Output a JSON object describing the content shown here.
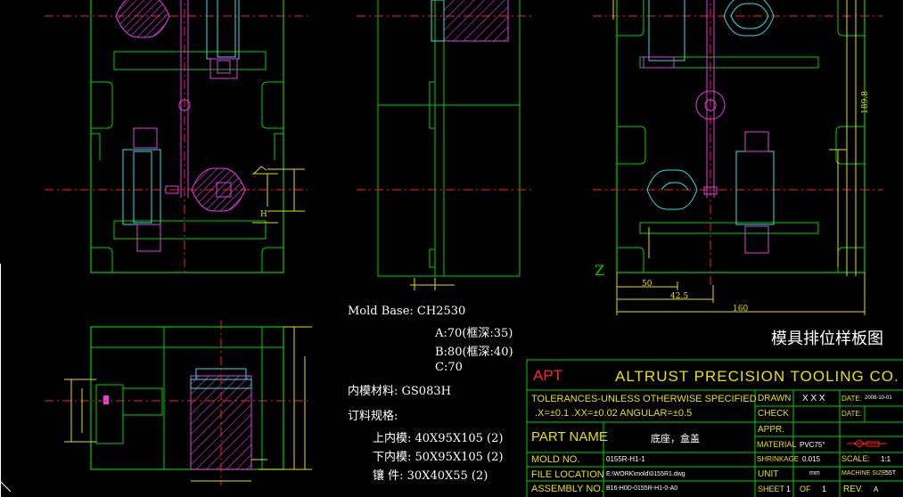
{
  "drawing_title": "模具排位样板图",
  "view_label": "Z",
  "notes": {
    "mold_base": "Mold Base: CH2530",
    "plate_a": "A:70(框深:35)",
    "plate_b": "B:80(框深:40)",
    "plate_c": "C:70",
    "insert_material": "内模材料: GS083H",
    "order_spec": "订料规格:",
    "upper_insert": "上内模: 40X95X105   (2)",
    "lower_insert": "下内模: 50X95X105   (2)",
    "slider": "镶  件: 30X40X55   (2)"
  },
  "dimensions": {
    "top_50": "50",
    "top_42": "42.5",
    "top_160": "160",
    "side_right": "189.8",
    "left_h": "H"
  },
  "title_block": {
    "logo": "APT",
    "company": "ALTRUST PRECISION TOOLING CO. LTD.",
    "tolerance_header": "TOLERANCES-UNLESS OTHERWISE SPECIFIED",
    "tolerance_values": ".X=±0.1   .XX=±0.02   ANGULAR=±0.5",
    "part_name_label": "PART NAME",
    "part_name_value": "底座，盒盖",
    "mold_no_label": "MOLD NO.",
    "mold_no_value": "0155R-H1-1",
    "file_location_label": "FILE LOCATION",
    "file_location_value": "E:\\WORK\\mold\\0155R1.dwg",
    "assembly_no_label": "ASSEMBLY NO.",
    "assembly_no_value": "B16-H0D-0155R-H1-0-A0",
    "drawn_label": "DRAWN",
    "drawn_value": "X X X",
    "check_label": "CHECK",
    "appr_label": "APPR.",
    "material_label": "MATERIAL",
    "material_value": "PVC75°",
    "shrinkage_label": "SHRINKAGE",
    "shrinkage_value": "0.015",
    "unit_label": "UNIT",
    "unit_value": "mm",
    "sheet_label": "SHEET",
    "sheet_value": "1",
    "of_label": "OF",
    "of_value": "1",
    "date_label": "DATE:",
    "date_value": "2008-10-01",
    "date2_label": "DATE:",
    "scale_label": "SCALE:",
    "scale_value": "1:1",
    "machine_size_label": "MACHINE SIZE:",
    "machine_size_value": "55T",
    "rev_label": "REV.",
    "rev_value": "A"
  },
  "colors": {
    "background": "#000000",
    "outline_green": "#00d000",
    "center_red": "#ff2020",
    "magenta": "#e040e0",
    "cyan": "#30e0e0",
    "yellow": "#e8e000",
    "text_white": "#ffffff"
  }
}
